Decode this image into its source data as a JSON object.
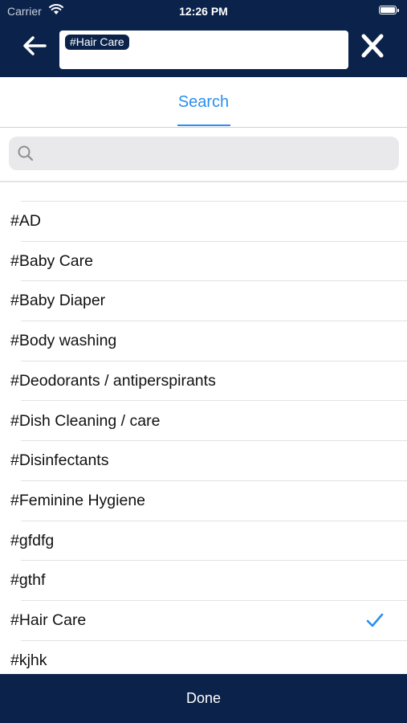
{
  "status_bar": {
    "carrier": "Carrier",
    "time": "12:26 PM"
  },
  "header": {
    "selected_tag": "#Hair Care"
  },
  "segment": {
    "active_tab": "Search"
  },
  "search": {
    "placeholder": ""
  },
  "list": {
    "items": [
      {
        "label": "#AD",
        "checked": false
      },
      {
        "label": "#Baby Care",
        "checked": false
      },
      {
        "label": "#Baby Diaper",
        "checked": false
      },
      {
        "label": "#Body washing",
        "checked": false
      },
      {
        "label": "#Deodorants / antiperspirants",
        "checked": false
      },
      {
        "label": "#Dish Cleaning / care",
        "checked": false
      },
      {
        "label": "#Disinfectants",
        "checked": false
      },
      {
        "label": "#Feminine Hygiene",
        "checked": false
      },
      {
        "label": "#gfdfg",
        "checked": false
      },
      {
        "label": "#gthf",
        "checked": false
      },
      {
        "label": "#Hair Care",
        "checked": true
      },
      {
        "label": "#kjhk",
        "checked": false
      }
    ]
  },
  "footer": {
    "done_label": "Done"
  },
  "colors": {
    "navy": "#0b234a",
    "accent_blue": "#2a8ff0"
  },
  "icons": {
    "back": "arrow-left-icon",
    "close": "close-icon",
    "search": "search-icon",
    "check": "checkmark-icon",
    "wifi": "wifi-icon",
    "battery": "battery-icon"
  }
}
